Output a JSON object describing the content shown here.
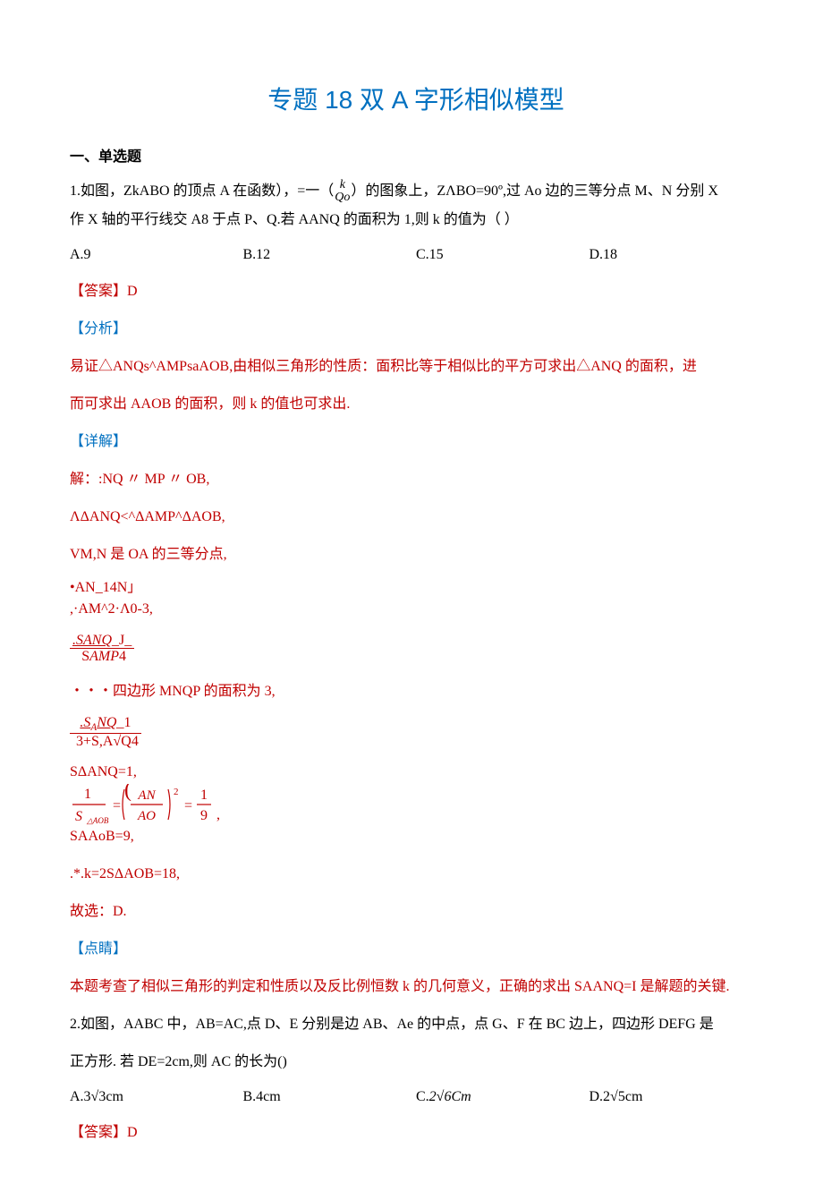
{
  "title": "专题 18 双 A 字形相似模型",
  "section1": "一、单选题",
  "q1": {
    "stem_pre": "1.如图，ZkABO 的顶点 A 在函数），=一（",
    "frac_num": "k",
    "frac_den": "Qo",
    "stem_post": "）的图象上，ZΛBO=90º,过 Ao 边的三等分点 M、N 分别 X",
    "stem2": "作 X 轴的平行线交 A8 于点 P、Q.若 AANQ 的面积为 1,则 k 的值为（                            ）",
    "optA": "A.9",
    "optB": "B.12",
    "optC": "C.15",
    "optD": "D.18",
    "ans_label": "【答案】",
    "ans": "D",
    "analysis_label": "【分析】",
    "analysis1": "易证△ANQs^AMPsaAOB,由相似三角形的性质：面积比等于相似比的平方可求出△ANQ 的面积，进",
    "analysis2": "而可求出 AAOB 的面积，则 k 的值也可求出.",
    "detail_label": "【详解】",
    "d1": "解：:NQ 〃 MP 〃 OB,",
    "d2": "ΛΔANQ<^ΔAMP^ΔAOB,",
    "d3": "VM,N 是 OA 的三等分点,",
    "d4a": "•AN_1",
    "d4b": "4N」",
    "d5": ",·AM^2·Λ0-3,",
    "d6_num": ".SANQ",
    "d6_num2": "_J_",
    "d6_den": "SAMP",
    "d6_den2": "4",
    "d7": "・・・四边形 MNQP 的面积为 3,",
    "d8_num": ".SANQ",
    "d8_num2": "_1",
    "d8_den_pre": "3+S,A",
    "d8_den_rad": "√Q",
    "d8_den2": "4",
    "d9": "SΔANQ=1,",
    "d10_alt": "1 / S_AOB = (AN / AO)^2 = 1/9 ,",
    "d11": "SAAoB=9,",
    "d12": ".*.k=2SΔAOB=18,",
    "d13": "故选：D.",
    "point_label": "【点睛】",
    "point": "本题考查了相似三角形的判定和性质以及反比例恒数 k 的几何意义，正确的求出 SAANQ=I 是解题的关键."
  },
  "q2": {
    "stem1": "2.如图，AABC 中，AB=AC,点 D、E 分别是边 AB、Ae 的中点，点 G、F 在 BC 边上，四边形 DEFG 是",
    "stem2": "正方形. 若 DE=2cm,则 AC 的长为()",
    "optA": "A.3√3cm",
    "optB": "B.4cm",
    "optC_pre": "C.",
    "optC_val": "2√6Cm",
    "optD": "D.2√5cm",
    "ans_label": "【答案】",
    "ans": "D"
  }
}
